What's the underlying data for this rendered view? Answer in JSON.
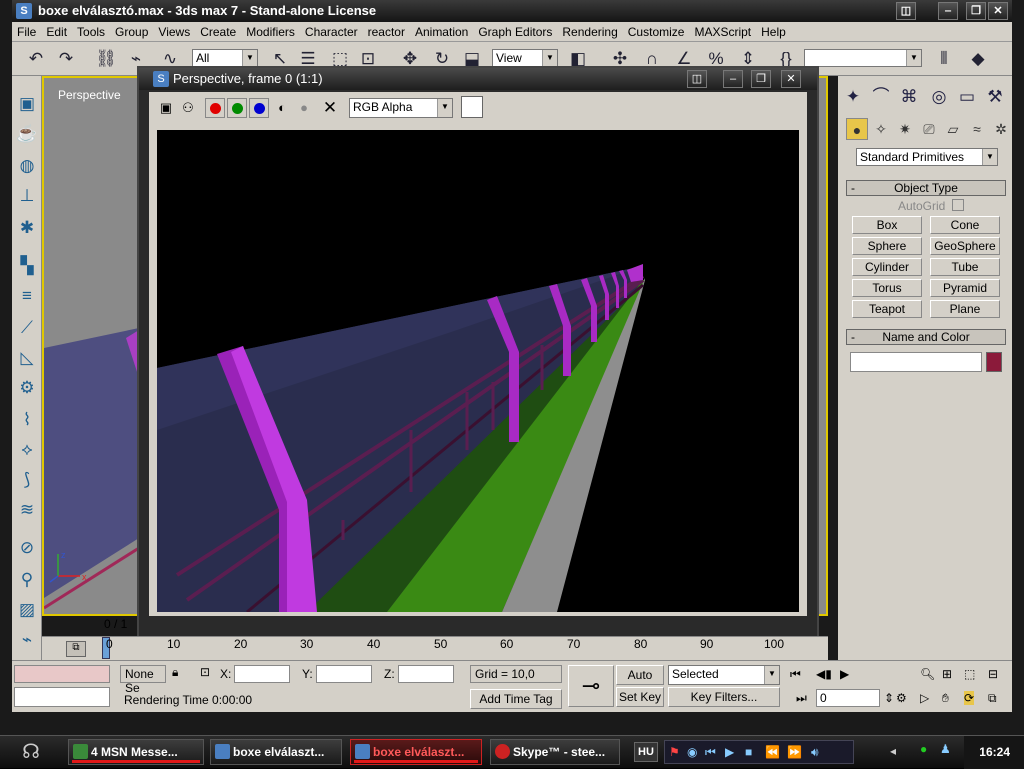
{
  "window": {
    "title": "boxe elválasztó.max - 3ds max 7  - Stand-alone License",
    "controls": [
      "minimize-icon",
      "maximize-icon",
      "close-icon"
    ]
  },
  "menu": [
    "File",
    "Edit",
    "Tools",
    "Group",
    "Views",
    "Create",
    "Modifiers",
    "Character",
    "reactor",
    "Animation",
    "Graph Editors",
    "Rendering",
    "Customize",
    "MAXScript",
    "Help"
  ],
  "toolbar": {
    "selection_filter": "All",
    "ref_coord": "View",
    "named_selection": ""
  },
  "viewport": {
    "label": "Perspective",
    "frame_counter": "0 / 1"
  },
  "render_window": {
    "title": "Perspective, frame 0 (1:1)",
    "channel_select": "RGB Alpha"
  },
  "command_panel": {
    "category": "Standard Primitives",
    "object_type_header": "Object Type",
    "autogrid": "AutoGrid",
    "buttons": [
      "Box",
      "Cone",
      "Sphere",
      "GeoSphere",
      "Cylinder",
      "Tube",
      "Torus",
      "Pyramid",
      "Teapot",
      "Plane"
    ],
    "name_color_header": "Name and Color",
    "object_color": "#8b1a3a"
  },
  "timeline": {
    "ticks": [
      "0",
      "10",
      "20",
      "30",
      "40",
      "50",
      "60",
      "70",
      "80",
      "90",
      "100"
    ]
  },
  "status": {
    "selection": "None Se",
    "x_label": "X:",
    "y_label": "Y:",
    "z_label": "Z:",
    "grid": "Grid = 10,0",
    "rendering_time": "Rendering Time  0:00:00",
    "add_time_tag": "Add Time Tag",
    "auto_key": "Auto Key",
    "set_key": "Set Key",
    "key_mode": "Selected",
    "key_filters": "Key Filters...",
    "frame": "0"
  },
  "taskbar": {
    "tasks": [
      {
        "label": "4 MSN Messe...",
        "active": false
      },
      {
        "label": "boxe elválaszt...",
        "active": false
      },
      {
        "label": "boxe elválaszt...",
        "active": true
      },
      {
        "label": "Skype™ - stee...",
        "active": false
      }
    ],
    "language": "HU",
    "clock": "16:24"
  }
}
